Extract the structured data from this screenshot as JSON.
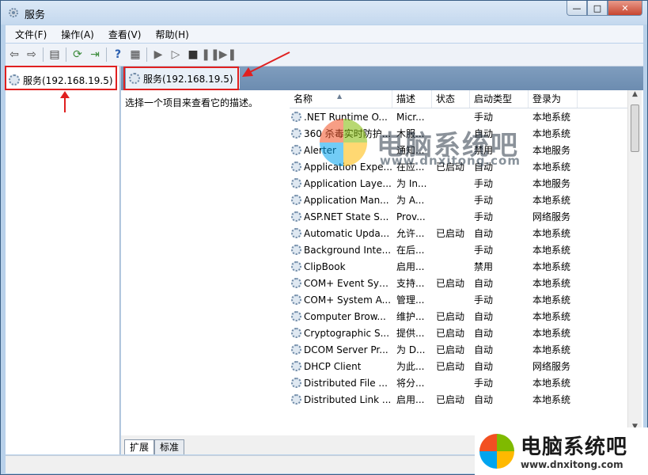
{
  "window": {
    "title": "服务",
    "controls": {
      "minimize": "—",
      "maximize": "□",
      "close": "✕"
    }
  },
  "menubar": {
    "items": [
      "文件(F)",
      "操作(A)",
      "查看(V)",
      "帮助(H)"
    ]
  },
  "toolbar": {
    "icons": [
      "back-icon",
      "forward-icon",
      "show-hide-tree-icon",
      "refresh-icon",
      "export-list-icon",
      "help-icon",
      "properties-icon",
      "start-icon",
      "start-alt-icon",
      "stop-icon",
      "pause-icon",
      "restart-icon"
    ]
  },
  "tree": {
    "root_label": "服务(192.168.19.5)"
  },
  "right_pane": {
    "header_label": "服务(192.168.19.5)",
    "description_prompt": "选择一个项目来查看它的描述。",
    "columns": [
      "名称",
      "描述",
      "状态",
      "启动类型",
      "登录为"
    ],
    "rows": [
      {
        "name": ".NET Runtime O...",
        "desc": "Micr...",
        "status": "",
        "startup": "手动",
        "logon": "本地系统"
      },
      {
        "name": "360 杀毒实时防护...",
        "desc": "木服...",
        "status": "",
        "startup": "自动",
        "logon": "本地系统"
      },
      {
        "name": "Alerter",
        "desc": "通知...",
        "status": "",
        "startup": "禁用",
        "logon": "本地服务"
      },
      {
        "name": "Application Expe...",
        "desc": "在应...",
        "status": "已启动",
        "startup": "自动",
        "logon": "本地系统"
      },
      {
        "name": "Application Laye...",
        "desc": "为 In...",
        "status": "",
        "startup": "手动",
        "logon": "本地服务"
      },
      {
        "name": "Application Man...",
        "desc": "为 A...",
        "status": "",
        "startup": "手动",
        "logon": "本地系统"
      },
      {
        "name": "ASP.NET State S...",
        "desc": "Prov...",
        "status": "",
        "startup": "手动",
        "logon": "网络服务"
      },
      {
        "name": "Automatic Upda...",
        "desc": "允许...",
        "status": "已启动",
        "startup": "自动",
        "logon": "本地系统"
      },
      {
        "name": "Background Inte...",
        "desc": "在后...",
        "status": "",
        "startup": "手动",
        "logon": "本地系统"
      },
      {
        "name": "ClipBook",
        "desc": "启用...",
        "status": "",
        "startup": "禁用",
        "logon": "本地系统"
      },
      {
        "name": "COM+ Event Sys...",
        "desc": "支持...",
        "status": "已启动",
        "startup": "自动",
        "logon": "本地系统"
      },
      {
        "name": "COM+ System A...",
        "desc": "管理...",
        "status": "",
        "startup": "手动",
        "logon": "本地系统"
      },
      {
        "name": "Computer Brow...",
        "desc": "维护...",
        "status": "已启动",
        "startup": "自动",
        "logon": "本地系统"
      },
      {
        "name": "Cryptographic S...",
        "desc": "提供...",
        "status": "已启动",
        "startup": "自动",
        "logon": "本地系统"
      },
      {
        "name": "DCOM Server Pr...",
        "desc": "为 D...",
        "status": "已启动",
        "startup": "自动",
        "logon": "本地系统"
      },
      {
        "name": "DHCP Client",
        "desc": "为此...",
        "status": "已启动",
        "startup": "自动",
        "logon": "网络服务"
      },
      {
        "name": "Distributed File ...",
        "desc": "将分...",
        "status": "",
        "startup": "手动",
        "logon": "本地系统"
      },
      {
        "name": "Distributed Link ...",
        "desc": "启用...",
        "status": "已启动",
        "startup": "自动",
        "logon": "本地系统"
      }
    ],
    "tabs": [
      "扩展",
      "标准"
    ]
  },
  "watermark": {
    "brand": "电脑系统吧",
    "url": "www.dnxitong.com",
    "logo_colors": [
      "#f25022",
      "#7fba00",
      "#00a4ef",
      "#ffb900"
    ]
  },
  "annotation_color": "#e02020"
}
